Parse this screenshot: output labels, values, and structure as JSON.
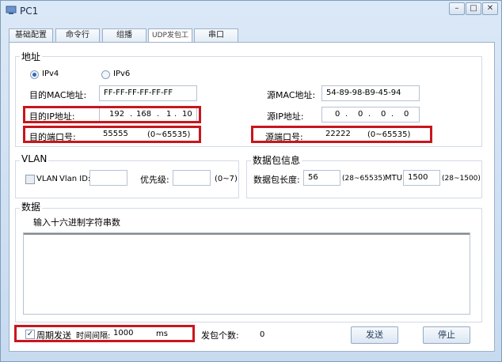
{
  "window": {
    "title": "PC1",
    "min_glyph": "–",
    "max_glyph": "□",
    "close_glyph": "✕"
  },
  "tabs": [
    {
      "label": "基础配置"
    },
    {
      "label": "命令行"
    },
    {
      "label": "组播"
    },
    {
      "label": "UDP发包工具"
    },
    {
      "label": "串口"
    }
  ],
  "address": {
    "title": "地址",
    "ipv4_label": "IPv4",
    "ipv6_label": "IPv6",
    "ip_version_selected": "IPv4",
    "dst_mac_label": "目的MAC地址:",
    "dst_mac_value": "FF-FF-FF-FF-FF-FF",
    "src_mac_label": "源MAC地址:",
    "src_mac_value": "54-89-98-B9-45-94",
    "dst_ip_label": "目的IP地址:",
    "dst_ip": [
      "192",
      "168",
      "1",
      "10"
    ],
    "src_ip_label": "源IP地址:",
    "src_ip": [
      "0",
      "0",
      "0",
      "0"
    ],
    "dst_port_label": "目的端口号:",
    "dst_port_value": "55555",
    "dst_port_range": "(0~65535)",
    "src_port_label": "源端口号:",
    "src_port_value": "22222",
    "src_port_range": "(0~65535)",
    "ip_dot": "."
  },
  "vlan": {
    "title": "VLAN",
    "checkbox_label": "VLAN",
    "checked": false,
    "vlan_id_label": "Vlan ID:",
    "vlan_id_value": "",
    "priority_label": "优先级:",
    "priority_value": "",
    "priority_range": "(0~7)"
  },
  "packet_info": {
    "title": "数据包信息",
    "length_label": "数据包长度:",
    "length_value": "56",
    "length_range": "(28~65535)",
    "mtu_label": "MTU:",
    "mtu_value": "1500",
    "mtu_range": "(28~1500)"
  },
  "data": {
    "title": "数据",
    "hint": "输入十六进制字符串数",
    "value": ""
  },
  "bottom": {
    "periodic_label": "周期发送",
    "periodic_checked": true,
    "interval_label": "时间间隔:",
    "interval_value": "1000",
    "interval_unit": "ms",
    "count_label": "发包个数:",
    "count_value": "0",
    "send_label": "发送",
    "stop_label": "停止"
  },
  "colors": {
    "highlight": "#c8161d",
    "accent": "#2d6ac7"
  }
}
